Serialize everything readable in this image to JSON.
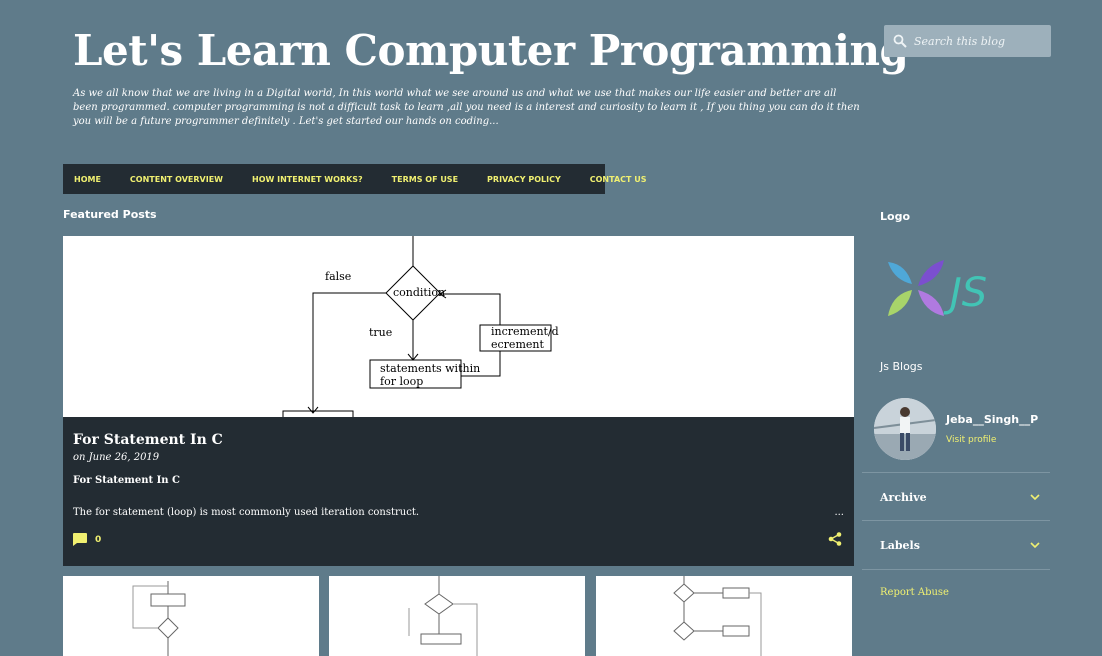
{
  "blog": {
    "title": "Let's Learn Computer Programming",
    "description": "As we all know that we are living in a Digital world, In this world what we see around us and what we use that makes our life easier and better are all been programmed. computer programming is not a difficult task to learn ,all you need is a interest and curiosity to learn it , If you thing you can do it then you will be a future programmer definitely . Let's get started our hands on coding..."
  },
  "search": {
    "placeholder": "Search this blog"
  },
  "nav": {
    "items": [
      "HOME",
      "CONTENT OVERVIEW",
      "HOW INTERNET WORKS?",
      "TERMS OF USE",
      "PRIVACY POLICY",
      "CONTACT US"
    ]
  },
  "featured": {
    "heading": "Featured Posts",
    "post_title": "For Statement In C",
    "date": "on June 26, 2019",
    "subtitle": "For Statement In C",
    "snippet": "The for statement (loop) is most commonly used iteration construct.",
    "more": "...",
    "comment_count": "0",
    "diagram": {
      "false_label": "false",
      "condition_label": "condition",
      "true_label": "true",
      "incr_line1": "increment/d",
      "incr_line2": "ecrement",
      "stmt_line1": "statements within",
      "stmt_line2": "for loop"
    }
  },
  "sidebar": {
    "logo_heading": "Logo",
    "logo_text": "JS",
    "blogs_heading": "Js Blogs",
    "profile_name": "Jeba__Singh__P",
    "profile_link": "Visit profile",
    "archive_label": "Archive",
    "labels_label": "Labels",
    "report_label": "Report Abuse"
  },
  "colors": {
    "background": "#5f7b8a",
    "nav_bg": "#232c33",
    "accent": "#f0f071"
  },
  "icons": [
    "search-icon",
    "comment-icon",
    "share-icon",
    "chevron-down-icon"
  ]
}
